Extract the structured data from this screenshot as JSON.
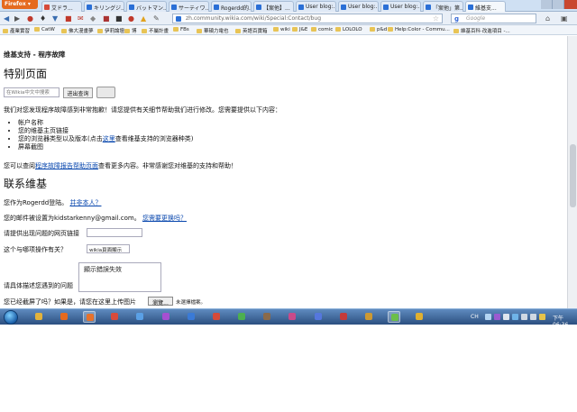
{
  "browser": {
    "app_button": "Firefox",
    "tabs": [
      {
        "label": "艾ドラ...",
        "color": "#d64a3a"
      },
      {
        "label": "キリングジ...",
        "color": "#2a6fd6"
      },
      {
        "label": "バットマン...",
        "color": "#2a6fd6"
      },
      {
        "label": "サーティワ...",
        "color": "#2a6fd6"
      },
      {
        "label": "Rogerdd的...",
        "color": "#2a6fd6"
      },
      {
        "label": "【案他】...",
        "color": "#2a6fd6"
      },
      {
        "label": "User blog:...",
        "color": "#2a6fd6"
      },
      {
        "label": "User blog:...",
        "color": "#2a6fd6"
      },
      {
        "label": "User blog:...",
        "color": "#2a6fd6"
      },
      {
        "label": "「案他」第...",
        "color": "#2a6fd6"
      },
      {
        "label": "維基支...",
        "color": "#2a6fd6",
        "active": true
      }
    ],
    "nav_icons": [
      "back-icon",
      "forward-icon",
      "home-icon",
      "addon-icon"
    ],
    "url": "zh.community.wikia.com/wiki/Special:Contact/bug",
    "search_placeholder": "Google",
    "search_engine_glyph": "g",
    "bookmarks": [
      "產業實習",
      "CatW",
      "佛大漫畫夢",
      "伊莉論壇",
      "博",
      "不屬計畫",
      "FBs",
      "華碩力電也",
      "英語百寶箱",
      "wiki",
      "J&E",
      "comic",
      "LOLOLO",
      "p&d",
      "Help:Color - Commu...",
      "維基百科·改進項目 -..."
    ]
  },
  "page": {
    "breadcrumb": "维基支持 - 程序故障",
    "title": "特别页面",
    "search_placeholder": "在Wikia中文中搜索",
    "search_button": "进出查询",
    "intro": "我们对您发现程序故障感到非常抱歉！请您提供有关细节帮助我们进行修改。您需要提供以下内容：",
    "requirements": [
      {
        "text": "帐户名称"
      },
      {
        "text": "您的维基主页链接"
      },
      {
        "text_before": "您的浏览器类型以及版本(点击",
        "link": "这里",
        "text_after": "查看维基支持的浏览器种类)"
      },
      {
        "text": "屏幕截图"
      }
    ],
    "more_help": {
      "before": "您可以查阅",
      "link": "程序故障报告帮助页面",
      "after": "查看更多内容。非常感谢您对维基的支持和帮助！"
    },
    "contact_title": "联系维基",
    "logged_in": {
      "before": "您作为Rogerdd登陆。",
      "link": "并非本人？"
    },
    "email": {
      "before": "您的邮件被设置为kidstarkenny@gmail.com。",
      "link": "您需要更换吗？"
    },
    "url_label": "请提供出现问题的网页链接",
    "wiki_label": "这个与哪项操作有关？",
    "wiki_value": "wikia頁面顯示",
    "desc_value": "顯示錯誤失效",
    "desc_label": "请具体描述您遇到的问题",
    "screenshot_label": "您已经截屏了吗？如果是，请您在这里上传图片",
    "browse_button": "瀏覽...",
    "no_file": "未選擇檔案。"
  },
  "taskbar": {
    "apps": [
      {
        "icon": "explorer-icon",
        "color": "#e2b33c",
        "active": false
      },
      {
        "icon": "media-player-icon",
        "color": "#e66a1e",
        "active": false
      },
      {
        "icon": "firefox-icon",
        "color": "#e7722c",
        "active": true
      },
      {
        "icon": "app-icon-1",
        "color": "#d94b3b",
        "active": false
      },
      {
        "icon": "app-icon-2",
        "color": "#5aa0e6",
        "active": false
      },
      {
        "icon": "app-icon-3",
        "color": "#a64fd1",
        "active": false
      },
      {
        "icon": "app-icon-4",
        "color": "#3a7ad6",
        "active": false
      },
      {
        "icon": "app-icon-5",
        "color": "#d64a3a",
        "active": false
      },
      {
        "icon": "chrome-icon",
        "color": "#4caf50",
        "active": false
      },
      {
        "icon": "app-icon-6",
        "color": "#8a6a4a",
        "active": false
      },
      {
        "icon": "app-icon-7",
        "color": "#c94a8a",
        "active": false
      },
      {
        "icon": "app-icon-8",
        "color": "#5577dd",
        "active": false
      },
      {
        "icon": "app-icon-9",
        "color": "#c43a3a",
        "active": false
      },
      {
        "icon": "app-icon-10",
        "color": "#cc9933",
        "active": false
      },
      {
        "icon": "app-icon-11",
        "color": "#6bbf4a",
        "active": true
      },
      {
        "icon": "app-icon-12",
        "color": "#e0b030",
        "active": false
      }
    ],
    "lang": "CH",
    "clock": "下午 06:36"
  }
}
